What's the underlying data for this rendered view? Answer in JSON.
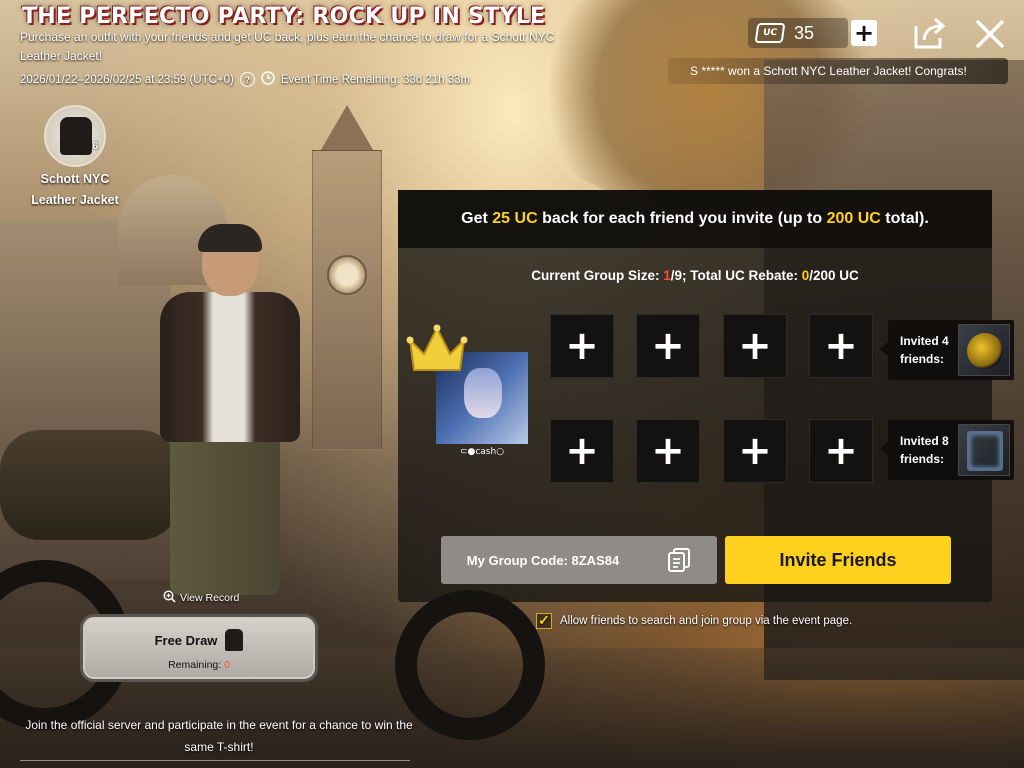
{
  "header": {
    "title": "THE PERFECTO PARTY: ROCK UP IN STYLE",
    "description": "Purchase an outfit with your friends and get UC back, plus earn the chance to draw for a Schott NYC Leather Jacket!",
    "event_dates": "2026/01/22–2026/02/25 at 23:59 (UTC+0)",
    "help_icon": "?",
    "time_remaining": "Event Time Remaining: 33d 21h 33m"
  },
  "prize": {
    "name": "Schott NYC Leather Jacket",
    "count": "6"
  },
  "currency": {
    "icon_label": "UC",
    "amount": "35",
    "add": "+"
  },
  "ticker": {
    "text": "S ***** won a Schott NYC Leather Jacket! Congrats!"
  },
  "panel": {
    "header_pre": "Get ",
    "header_uc1": "25 UC",
    "header_mid": " back for each friend you invite (up to ",
    "header_uc2": "200 UC",
    "header_post": " total).",
    "group_pre": "Current Group Size: ",
    "group_size": "1",
    "group_mid": "/9; Total UC Rebate: ",
    "rebate": "0",
    "group_post": "/200 UC",
    "leader_name": "⊂●cash○",
    "slot_symbol": "+",
    "reward_1": "Invited 4 friends:",
    "reward_2": "Invited 8 friends:",
    "group_code": "My Group Code: 8ZAS84",
    "invite_button": "Invite Friends"
  },
  "allow": {
    "checked": true,
    "check_mark": "✓",
    "label": "Allow friends to search and join group via the event page."
  },
  "draw": {
    "view_record": "View Record",
    "title": "Free Draw",
    "remaining_label": "Remaining: ",
    "remaining_value": "0"
  },
  "footer": {
    "note": "Join the official server and participate in the event for a chance to win the same T-shirt!"
  },
  "colors": {
    "accent": "#ffd11f",
    "highlight_red": "#ff4b3a"
  }
}
